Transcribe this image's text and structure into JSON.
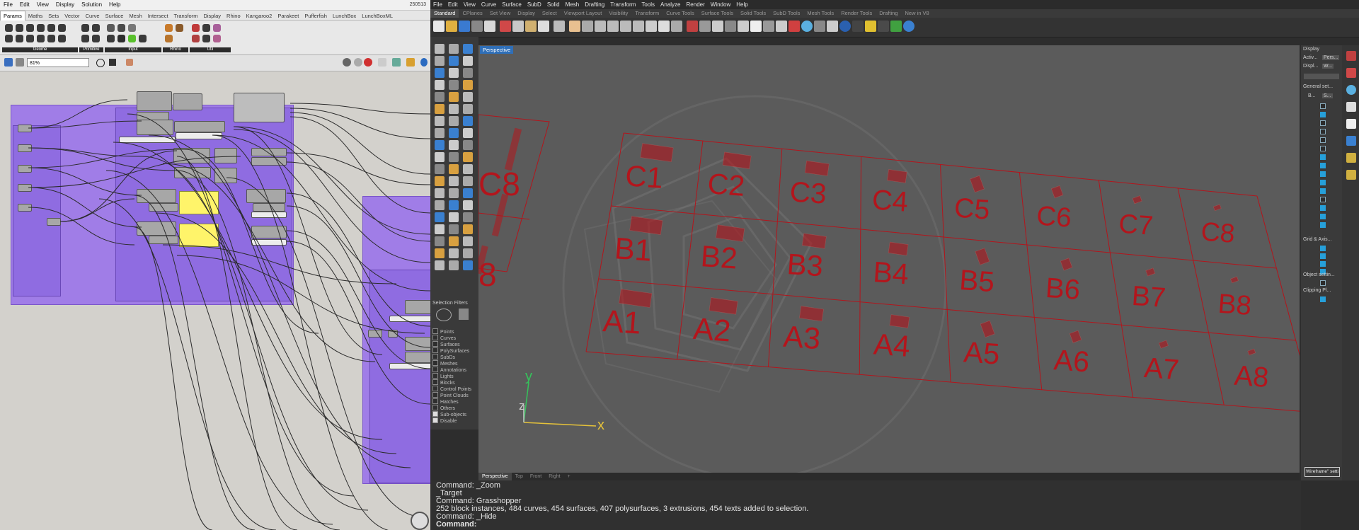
{
  "grasshopper": {
    "menu": [
      "File",
      "Edit",
      "View",
      "Display",
      "Solution",
      "Help"
    ],
    "version": "250513",
    "tabs": [
      "Params",
      "Maths",
      "Sets",
      "Vector",
      "Curve",
      "Surface",
      "Mesh",
      "Intersect",
      "Transform",
      "Display",
      "Rhino",
      "Kangaroo2",
      "Parakeet",
      "Pufferfish",
      "LunchBox",
      "LunchBoxML"
    ],
    "active_tab": "Params",
    "ribbon_groups": [
      "Geome",
      "Primitive",
      "Input",
      "Rhino",
      "Util"
    ],
    "zoom": "81%"
  },
  "rhino": {
    "menu": [
      "File",
      "Edit",
      "View",
      "Curve",
      "Surface",
      "SubD",
      "Solid",
      "Mesh",
      "Drafting",
      "Transform",
      "Tools",
      "Analyze",
      "Render",
      "Window",
      "Help"
    ],
    "tabs": [
      "Standard",
      "CPlanes",
      "Set View",
      "Display",
      "Select",
      "Viewport Layout",
      "Visibility",
      "Transform",
      "Curve Tools",
      "Surface Tools",
      "Solid Tools",
      "SubD Tools",
      "Mesh Tools",
      "Render Tools",
      "Drafting",
      "New in V8"
    ],
    "active_tab": "Standard",
    "viewport_title": "Perspective",
    "viewport_tabs": [
      "Perspective",
      "Top",
      "Front",
      "Right",
      "+"
    ],
    "active_viewport_tab": "Perspective",
    "axis_labels": {
      "x": "x",
      "y": "y",
      "z": "z"
    },
    "grid_labels": [
      "A1",
      "A2",
      "A3",
      "A4",
      "A5",
      "A6",
      "A7",
      "A8",
      "B1",
      "B2",
      "B3",
      "B4",
      "B5",
      "B6",
      "B7",
      "B8",
      "C1",
      "C2",
      "C3",
      "C4",
      "C5",
      "C6",
      "C7",
      "C8",
      "C8",
      "8"
    ],
    "selection_filters": {
      "title": "Selection Filters",
      "items": [
        {
          "label": "Points",
          "checked": false
        },
        {
          "label": "Curves",
          "checked": false
        },
        {
          "label": "Surfaces",
          "checked": false
        },
        {
          "label": "PolySurfaces",
          "checked": false
        },
        {
          "label": "SubDs",
          "checked": false
        },
        {
          "label": "Meshes",
          "checked": false
        },
        {
          "label": "Annotations",
          "checked": false
        },
        {
          "label": "Lights",
          "checked": false
        },
        {
          "label": "Blocks",
          "checked": false
        },
        {
          "label": "Control Points",
          "checked": false
        },
        {
          "label": "Point Clouds",
          "checked": false
        },
        {
          "label": "Hatches",
          "checked": false
        },
        {
          "label": "Others",
          "checked": false
        },
        {
          "label": "Sub-objects",
          "checked": true
        },
        {
          "label": "Disable",
          "checked": true
        }
      ]
    },
    "command_history": [
      "Command: _Zoom",
      "_Target",
      "Command: Grasshopper",
      "252 block instances, 484 curves, 454 surfaces, 407 polysurfaces, 3 extrusions, 454 texts added to selection.",
      "Command: _Hide"
    ],
    "command_prompt": "Command:",
    "display_panel": {
      "title": "Display",
      "active_label": "Activ...",
      "active_value": "Pers...",
      "display_label": "Displ...",
      "display_value": "W...",
      "general": "General set...",
      "b_label": "B...",
      "b_value": "S...",
      "grid_axes": "Grid & Axis...",
      "object_settings": "Object settin...",
      "clipping": "Clipping Pl...",
      "wireframe_button": "Wireframe\" setti"
    }
  },
  "colors": {
    "rhino_bg": "#2d2d2d",
    "viewport_bg": "#5b5b5b",
    "grid_red": "#b3151c",
    "gh_group": "#9a6ef0",
    "gh_panel": "#fff46a",
    "active_blue": "#2f6fb8",
    "axis_x": "#e5c23a",
    "axis_y": "#35c35b",
    "axis_z": "#c9c9c9"
  }
}
